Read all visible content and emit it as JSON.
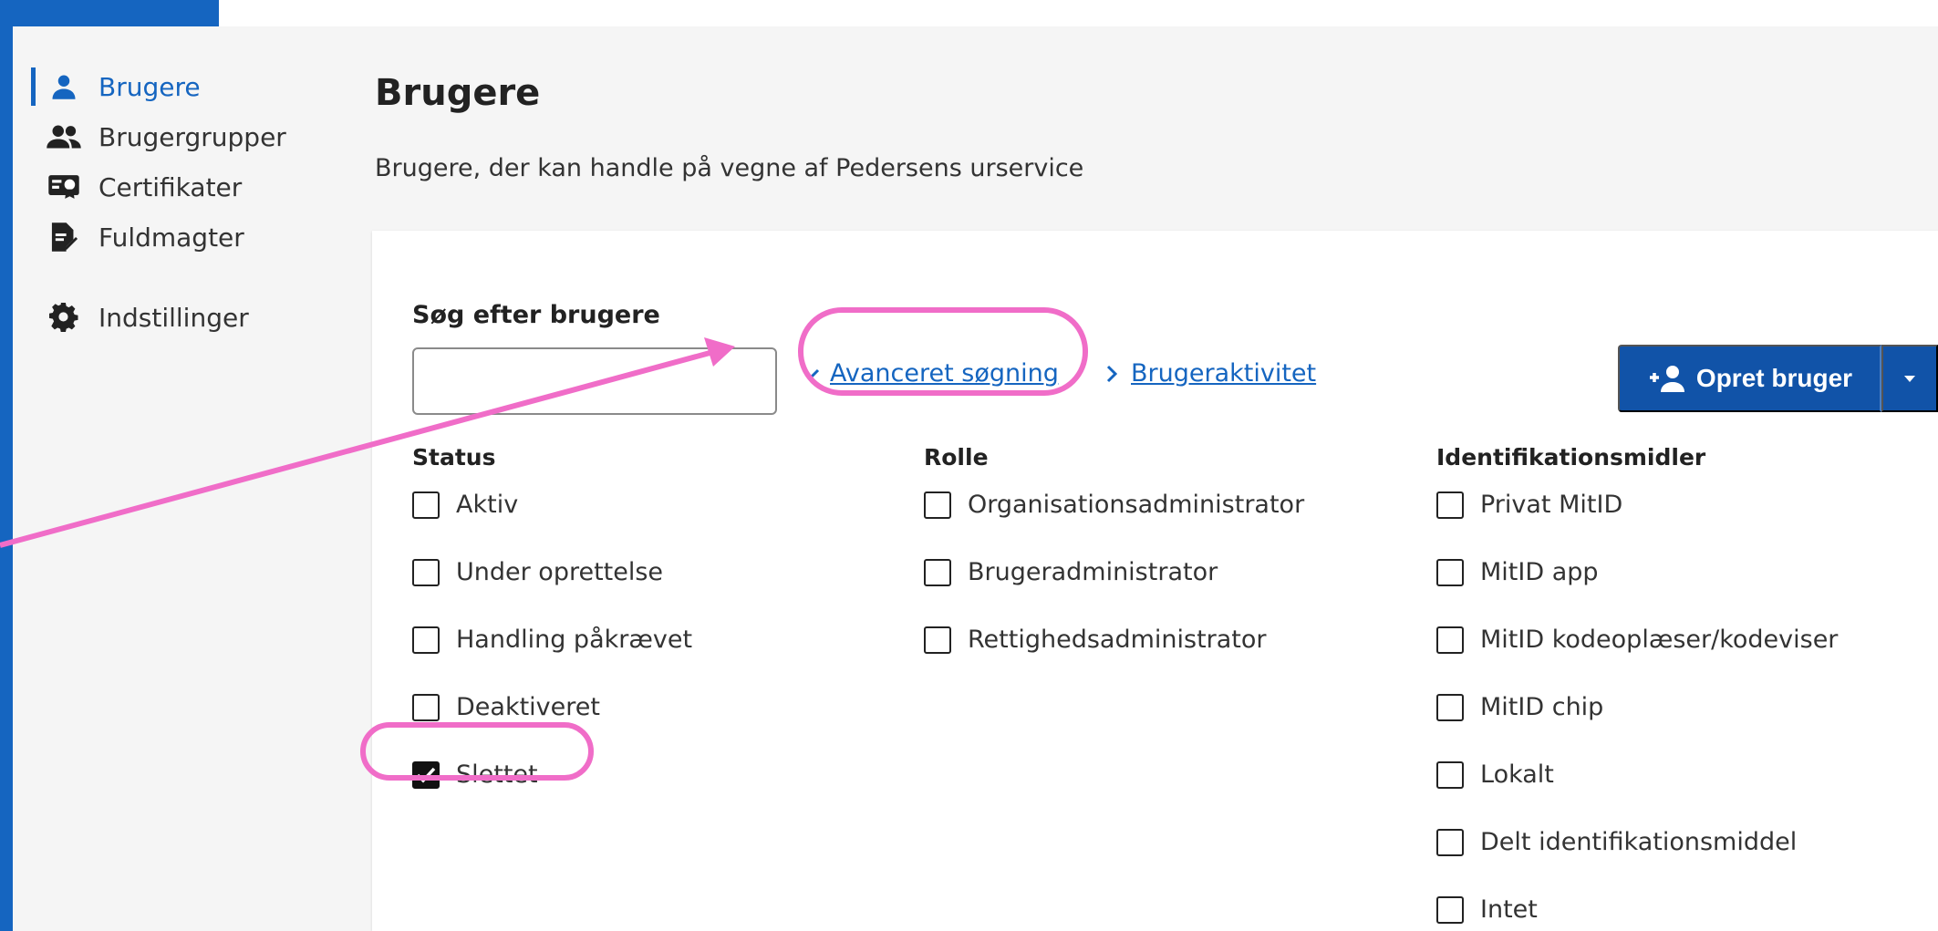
{
  "sidebar": {
    "items": [
      {
        "label": "Brugere",
        "icon": "user-icon",
        "active": true
      },
      {
        "label": "Brugergrupper",
        "icon": "users-icon"
      },
      {
        "label": "Certifikater",
        "icon": "certificate-icon"
      },
      {
        "label": "Fuldmagter",
        "icon": "document-sign-icon"
      },
      {
        "label": "Indstillinger",
        "icon": "gear-icon"
      }
    ]
  },
  "page": {
    "title": "Brugere",
    "subtitle": "Brugere, der kan handle på vegne af Pedersens urservice"
  },
  "search": {
    "label": "Søg efter brugere",
    "value": ""
  },
  "links": {
    "advanced": "Avanceret søgning",
    "activity": "Brugeraktivitet"
  },
  "create_button": {
    "label": "Opret bruger"
  },
  "filters": {
    "status": {
      "heading": "Status",
      "options": [
        {
          "label": "Aktiv",
          "checked": false
        },
        {
          "label": "Under oprettelse",
          "checked": false
        },
        {
          "label": "Handling påkrævet",
          "checked": false
        },
        {
          "label": "Deaktiveret",
          "checked": false
        },
        {
          "label": "Slettet",
          "checked": true
        }
      ]
    },
    "rolle": {
      "heading": "Rolle",
      "options": [
        {
          "label": "Organisationsadministrator",
          "checked": false
        },
        {
          "label": "Brugeradministrator",
          "checked": false
        },
        {
          "label": "Rettighedsadministrator",
          "checked": false
        }
      ]
    },
    "ident": {
      "heading": "Identifikationsmidler",
      "options": [
        {
          "label": "Privat MitID",
          "checked": false
        },
        {
          "label": "MitID app",
          "checked": false
        },
        {
          "label": "MitID kodeoplæser/kodeviser",
          "checked": false
        },
        {
          "label": "MitID chip",
          "checked": false
        },
        {
          "label": "Lokalt",
          "checked": false
        },
        {
          "label": "Delt identifikationsmiddel",
          "checked": false
        },
        {
          "label": "Intet",
          "checked": false
        }
      ]
    }
  },
  "colors": {
    "brand": "#1565c0",
    "button": "#1153a8",
    "annotation": "#f06dc8"
  }
}
